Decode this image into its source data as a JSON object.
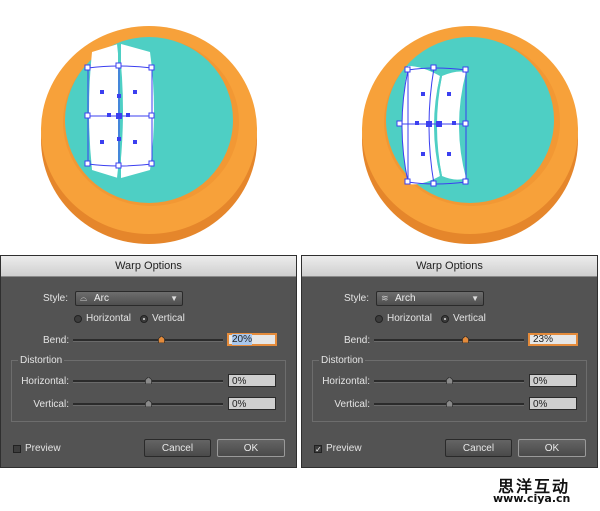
{
  "colors": {
    "rim_orange": "#f7a13a",
    "rim_shadow": "#e5862b",
    "inner_teal": "#4ecfc4",
    "selection_blue": "#3b3ff0",
    "dialog_bg": "#535353",
    "focus_orange": "#e48b3b"
  },
  "dialogs": [
    {
      "title": "Warp Options",
      "style_label": "Style:",
      "style_icon": "arc-style-icon",
      "style_value": "Arc",
      "orientation": {
        "horizontal_label": "Horizontal",
        "vertical_label": "Vertical",
        "selected": "Vertical"
      },
      "bend": {
        "label": "Bend:",
        "value": "20%",
        "percent": 20
      },
      "distortion": {
        "group_label": "Distortion",
        "horizontal": {
          "label": "Horizontal:",
          "value": "0%",
          "percent": 0
        },
        "vertical": {
          "label": "Vertical:",
          "value": "0%",
          "percent": 0
        }
      },
      "preview": {
        "label": "Preview",
        "checked": false
      },
      "cancel_label": "Cancel",
      "ok_label": "OK"
    },
    {
      "title": "Warp Options",
      "style_label": "Style:",
      "style_icon": "arch-style-icon",
      "style_value": "Arch",
      "orientation": {
        "horizontal_label": "Horizontal",
        "vertical_label": "Vertical",
        "selected": "Vertical"
      },
      "bend": {
        "label": "Bend:",
        "value": "23%",
        "percent": 23
      },
      "distortion": {
        "group_label": "Distortion",
        "horizontal": {
          "label": "Horizontal:",
          "value": "0%",
          "percent": 0
        },
        "vertical": {
          "label": "Vertical:",
          "value": "0%",
          "percent": 0
        }
      },
      "preview": {
        "label": "Preview",
        "checked": true
      },
      "cancel_label": "Cancel",
      "ok_label": "OK"
    }
  ],
  "watermark": {
    "cn": "思洋互动",
    "url": "www.ciya.cn"
  }
}
